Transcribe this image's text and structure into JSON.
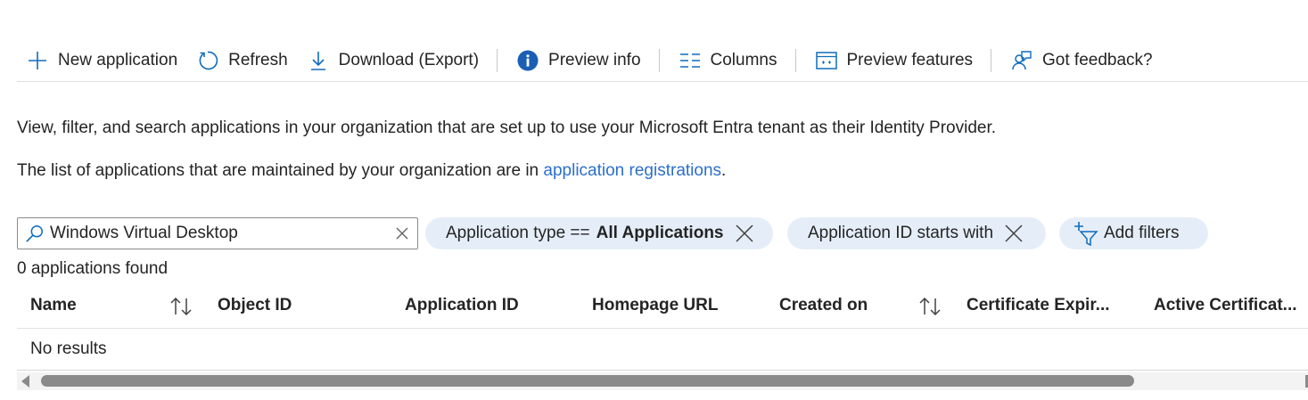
{
  "toolbar": {
    "new_application": "New application",
    "refresh": "Refresh",
    "download": "Download (Export)",
    "preview_info": "Preview info",
    "columns": "Columns",
    "preview_features": "Preview features",
    "feedback": "Got feedback?"
  },
  "description": {
    "line1": "View, filter, and search applications in your organization that are set up to use your Microsoft Entra tenant as their Identity Provider.",
    "line2_prefix": "The list of applications that are maintained by your organization are in ",
    "line2_link": "application registrations",
    "line2_suffix": "."
  },
  "search": {
    "value": "Windows Virtual Desktop"
  },
  "filters": {
    "app_type_label": "Application type ==",
    "app_type_value": "All Applications",
    "app_id_label": "Application ID starts with",
    "add_filters": "Add filters"
  },
  "results": {
    "count_text": "0 applications found",
    "empty_text": "No results"
  },
  "table": {
    "columns": [
      "Name",
      "Object ID",
      "Application ID",
      "Homepage URL",
      "Created on",
      "Certificate Expir...",
      "Active Certificat..."
    ]
  },
  "colors": {
    "accent": "#0f6cbd",
    "link": "#2b6fcc",
    "pill_bg": "#e5eef8",
    "info_icon": "#1a5fb4"
  },
  "icons": {
    "new_application": "plus-icon",
    "refresh": "refresh-icon",
    "download": "download-icon",
    "preview_info": "info-icon",
    "columns": "columns-icon",
    "preview_features": "preview-features-icon",
    "feedback": "feedback-icon",
    "search": "search-icon",
    "clear": "close-icon",
    "remove_filter": "close-icon",
    "add_filter": "add-filter-icon",
    "sort": "sort-icon"
  }
}
